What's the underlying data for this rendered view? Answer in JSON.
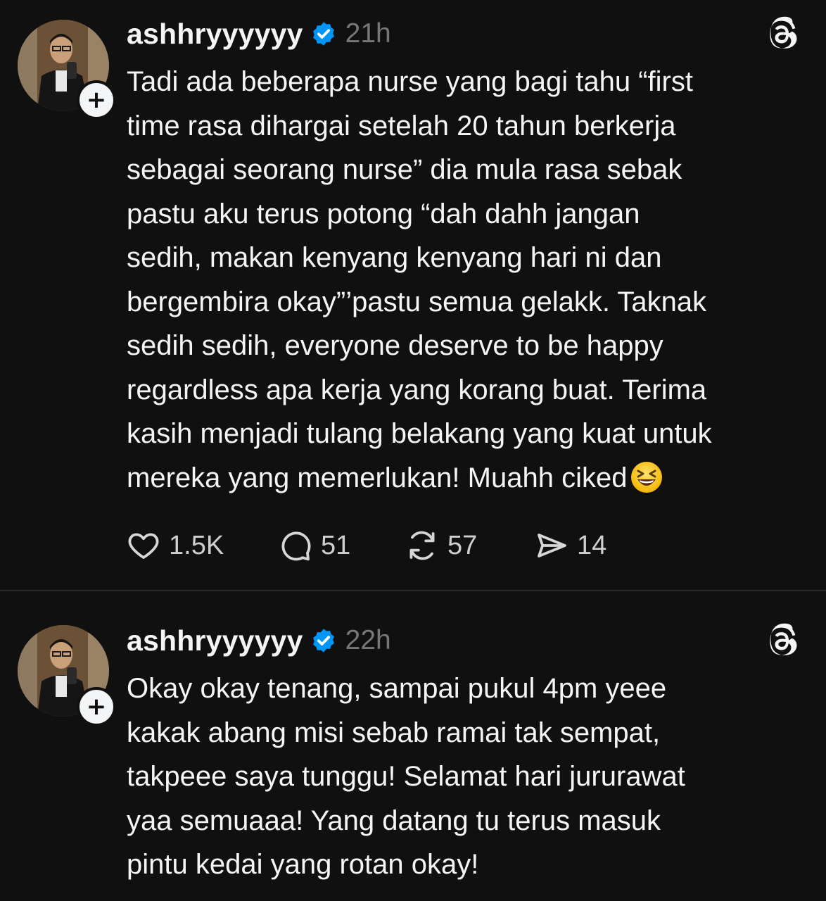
{
  "posts": [
    {
      "username": "ashhryyyyyy",
      "verified": true,
      "time": "21h",
      "text": "Tadi ada beberapa nurse yang bagi tahu “first\ntime rasa dihargai setelah 20 tahun berkerja\nsebagai seorang nurse” dia mula rasa sebak\npastu aku terus potong “dah dahh jangan\nsedih, makan kenyang kenyang hari ni dan\nbergembira okay”’pastu semua gelakk. Taknak\nsedih sedih, everyone deserve to be happy\nregardless apa kerja yang korang buat. Terima\nkasih menjadi tulang belakang yang kuat untuk\nmereka yang memerlukan! Muahh ciked",
      "emoji": "laughing-squinting-face",
      "stats": {
        "likes": "1.5K",
        "replies": "51",
        "reposts": "57",
        "shares": "14"
      }
    },
    {
      "username": "ashhryyyyyy",
      "verified": true,
      "time": "22h",
      "text": "Okay okay tenang, sampai pukul 4pm yeee\nkakak abang misi sebab ramai tak sempat,\ntakpeee saya tunggu! Selamat hari jururawat\nyaa semuaaa! Yang datang tu terus masuk\npintu kedai yang rotan okay!"
    }
  ],
  "follow_badge": "+",
  "colors": {
    "background": "#101010",
    "text": "#f3f5f7",
    "muted": "#777777",
    "verified": "#0095f6",
    "divider": "#2a2a2a"
  },
  "icons": {
    "app_logo": "threads-logo-icon",
    "like": "heart-icon",
    "reply": "comment-bubble-icon",
    "repost": "repost-icon",
    "share": "send-icon",
    "verified": "verified-badge-icon"
  }
}
